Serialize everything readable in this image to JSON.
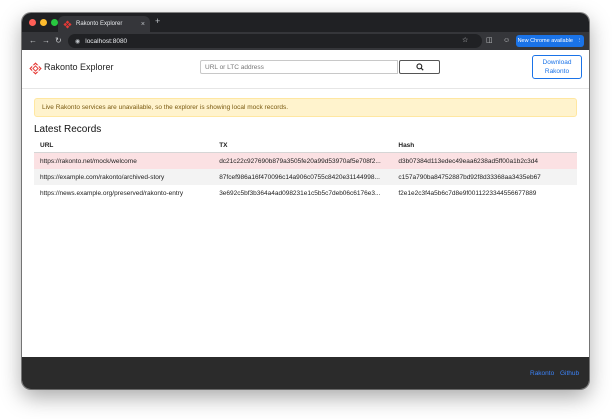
{
  "browser": {
    "tab_title": "Rakonto Explorer",
    "tab_close": "×",
    "new_tab": "+",
    "url": "localhost:8080",
    "update_button": "New Chrome available",
    "update_menu": "⋮"
  },
  "header": {
    "brand": "Rakonto Explorer",
    "search_placeholder": "URL or LTC address",
    "download_label_1": "Download",
    "download_label_2": "Rakonto"
  },
  "alert": {
    "message": "Live Rakonto services are unavailable, so the explorer is showing local mock records."
  },
  "records": {
    "title": "Latest Records",
    "columns": [
      "URL",
      "TX",
      "Hash"
    ],
    "rows": [
      {
        "url": "https://rakonto.net/mock/welcome",
        "tx": "dc21c22c927690b879a3505fe20a99d53970af5e708f2...",
        "hash": "d3b07384d113edec49eaa6238ad5ff00a1b2c3d4"
      },
      {
        "url": "https://example.com/rakonto/archived-story",
        "tx": "87fcef986a16f470096c14a906c0755c8420e31144998...",
        "hash": "c157a790ba84752887bd92f8d33368aa3435eb67"
      },
      {
        "url": "https://news.example.org/preserved/rakonto-entry",
        "tx": "3e692c5bf3b364a4ad098231e1c5b5c7deb06c6176e3...",
        "hash": "f2e1e2c3f4a5b6c7d8e9f0011223344556677889"
      }
    ]
  },
  "footer": {
    "link_rakonto": "Rakonto",
    "link_github": "Github"
  },
  "colors": {
    "accent": "#1a73e8",
    "alert_bg": "#fff3cd",
    "row_highlight": "#fbe1e3",
    "footer_bg": "#2b2b2b"
  }
}
